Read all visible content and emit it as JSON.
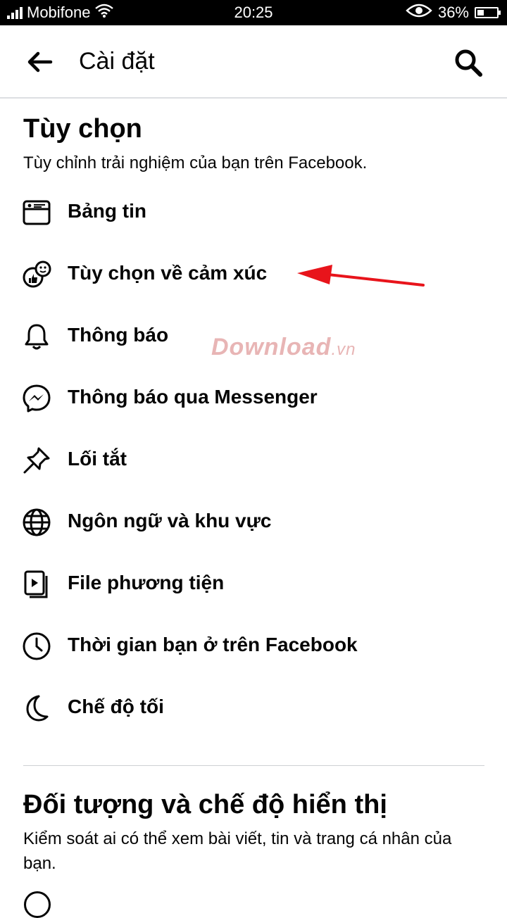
{
  "status_bar": {
    "carrier": "Mobifone",
    "time": "20:25",
    "battery": "36%",
    "battery_level": 0.36
  },
  "header": {
    "title": "Cài đặt",
    "back_icon": "back-arrow-icon",
    "search_icon": "search-icon"
  },
  "preferences": {
    "title": "Tùy chọn",
    "description": "Tùy chỉnh trải nghiệm của bạn trên Facebook.",
    "items": [
      {
        "label": "Bảng tin",
        "icon": "news-feed-icon"
      },
      {
        "label": "Tùy chọn về cảm xúc",
        "icon": "reactions-icon"
      },
      {
        "label": "Thông báo",
        "icon": "bell-icon"
      },
      {
        "label": "Thông báo qua Messenger",
        "icon": "messenger-icon"
      },
      {
        "label": "Lối tắt",
        "icon": "pin-icon"
      },
      {
        "label": "Ngôn ngữ và khu vực",
        "icon": "globe-icon"
      },
      {
        "label": "File phương tiện",
        "icon": "media-icon"
      },
      {
        "label": "Thời gian bạn ở trên Facebook",
        "icon": "clock-icon"
      },
      {
        "label": "Chế độ tối",
        "icon": "moon-icon"
      }
    ]
  },
  "audience": {
    "title": "Đối tượng và chế độ hiển thị",
    "description": "Kiểm soát ai có thể xem bài viết, tin và trang cá nhân của bạn."
  },
  "watermark": {
    "main": "Download",
    "domain": ".vn"
  },
  "colors": {
    "annotation_arrow": "#e8141b",
    "divider": "#ced0d4"
  }
}
